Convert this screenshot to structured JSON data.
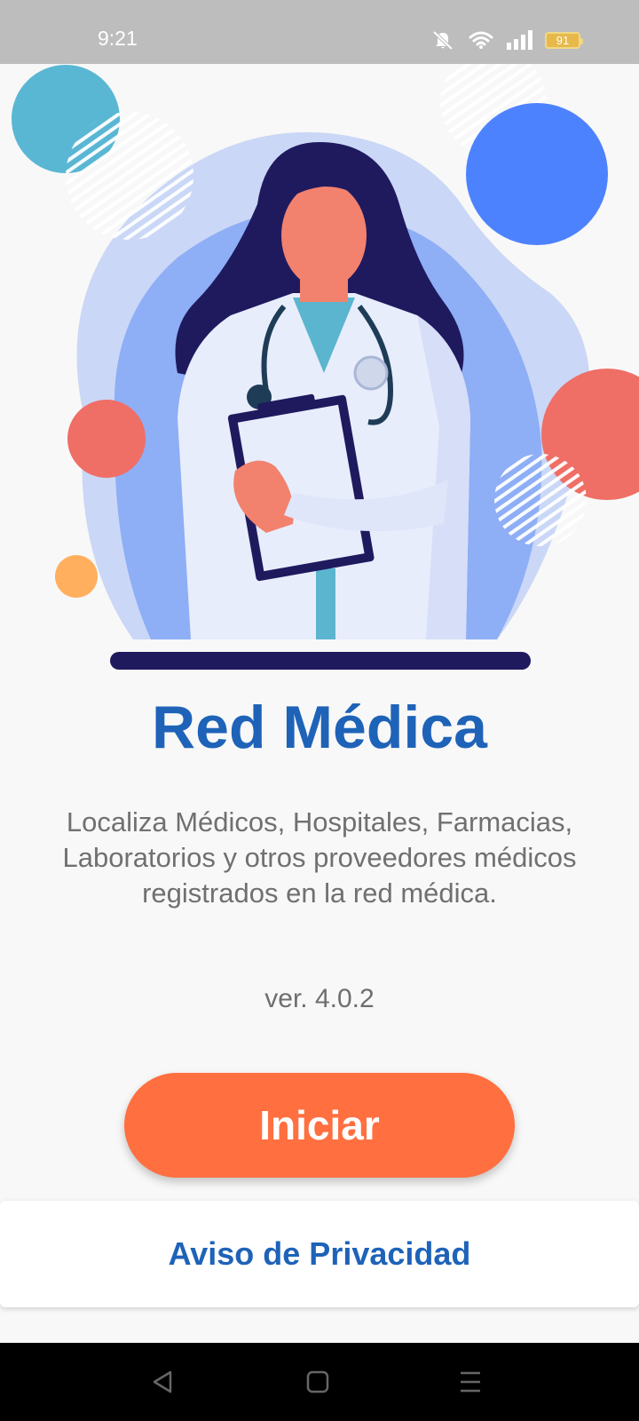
{
  "status_bar": {
    "time": "9:21",
    "battery_level": "91",
    "icons": [
      "mute-icon",
      "wifi-icon",
      "signal-icon",
      "battery-icon"
    ]
  },
  "hero": {
    "illustration": "doctor-with-clipboard-illustration"
  },
  "app": {
    "title": "Red Médica",
    "description": "Localiza Médicos, Hospitales, Farmacias, Laboratorios y otros proveedores médicos registrados en la red médica.",
    "version": "ver. 4.0.2"
  },
  "actions": {
    "start_label": "Iniciar",
    "privacy_label": "Aviso de Privacidad"
  },
  "nav_bar": {
    "icons": [
      "back-icon",
      "home-icon",
      "menu-icon"
    ]
  },
  "colors": {
    "brand_blue": "#1e63b8",
    "accent_orange": "#ff6f40",
    "status_bar": "#bdbdbd",
    "background": "#f8f8f8"
  }
}
